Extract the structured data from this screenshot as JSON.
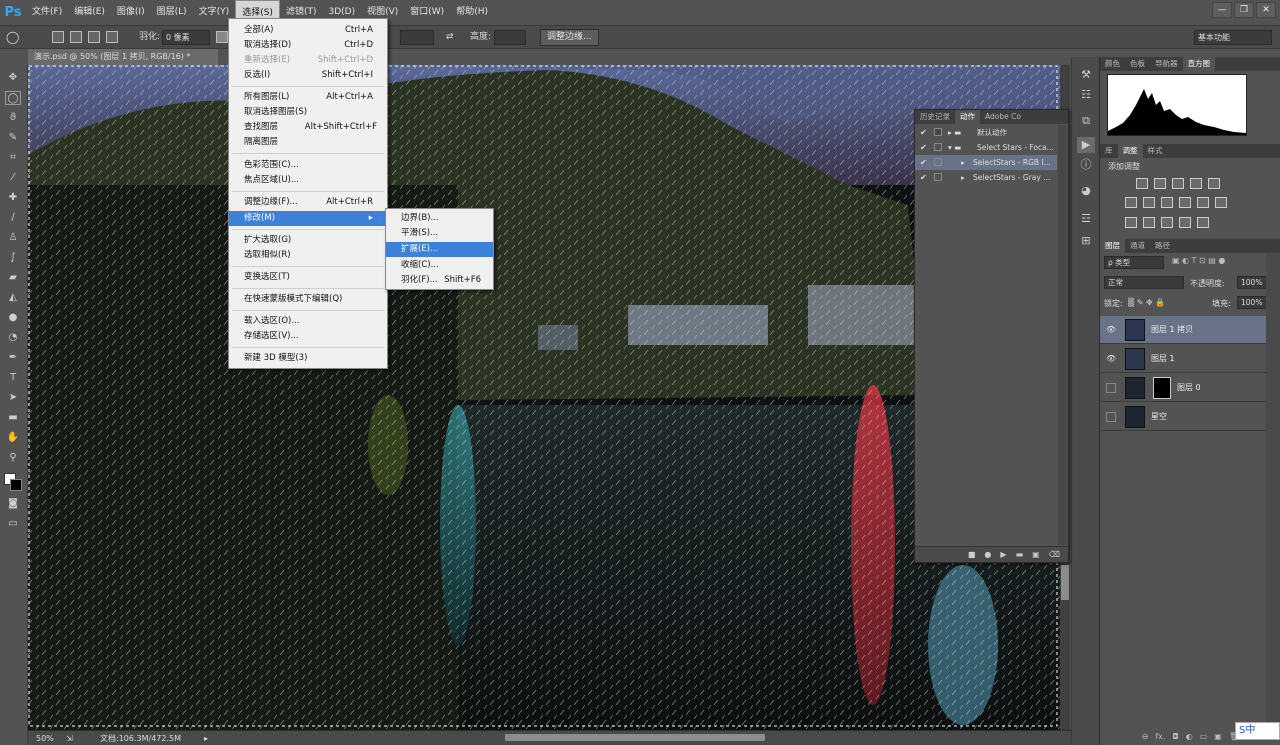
{
  "app": {
    "logo": "Ps"
  },
  "menubar": [
    "文件(F)",
    "编辑(E)",
    "图像(I)",
    "图层(L)",
    "文字(Y)",
    "选择(S)",
    "滤镜(T)",
    "3D(D)",
    "视图(V)",
    "窗口(W)",
    "帮助(H)"
  ],
  "window_controls": [
    "—",
    "❐",
    "✕"
  ],
  "options": {
    "feather_label": "羽化:",
    "feather_value": "0 像素",
    "height_label": "高度:",
    "refine_edge_button": "调整边缘...",
    "workspace": "基本功能"
  },
  "document": {
    "tab_title": "演示.psd @ 50% (图层 1 拷贝, RGB/16) *",
    "zoom": "50%",
    "doc_size": "文档:106.3M/472.5M"
  },
  "select_menu": [
    {
      "label": "全部(A)",
      "shortcut": "Ctrl+A"
    },
    {
      "label": "取消选择(D)",
      "shortcut": "Ctrl+D"
    },
    {
      "label": "重新选择(E)",
      "shortcut": "Shift+Ctrl+D"
    },
    {
      "label": "反选(I)",
      "shortcut": "Shift+Ctrl+I"
    },
    {
      "label": "所有图层(L)",
      "shortcut": "Alt+Ctrl+A"
    },
    {
      "label": "取消选择图层(S)",
      "shortcut": ""
    },
    {
      "label": "查找图层",
      "shortcut": "Alt+Shift+Ctrl+F"
    },
    {
      "label": "隔离图层",
      "shortcut": ""
    },
    {
      "label": "色彩范围(C)...",
      "shortcut": ""
    },
    {
      "label": "焦点区域(U)...",
      "shortcut": ""
    },
    {
      "label": "调整边缘(F)...",
      "shortcut": "Alt+Ctrl+R"
    },
    {
      "label": "修改(M)",
      "shortcut": "▸"
    },
    {
      "label": "扩大选取(G)",
      "shortcut": ""
    },
    {
      "label": "选取相似(R)",
      "shortcut": ""
    },
    {
      "label": "变换选区(T)",
      "shortcut": ""
    },
    {
      "label": "在快速蒙版模式下编辑(Q)",
      "shortcut": ""
    },
    {
      "label": "载入选区(O)...",
      "shortcut": ""
    },
    {
      "label": "存储选区(V)...",
      "shortcut": ""
    },
    {
      "label": "新建 3D 模型(3)",
      "shortcut": ""
    }
  ],
  "modify_submenu": [
    {
      "label": "边界(B)...",
      "shortcut": ""
    },
    {
      "label": "平滑(S)...",
      "shortcut": ""
    },
    {
      "label": "扩展(E)...",
      "shortcut": ""
    },
    {
      "label": "收缩(C)...",
      "shortcut": ""
    },
    {
      "label": "羽化(F)...",
      "shortcut": "Shift+F6"
    }
  ],
  "actions_panel": {
    "tabs": [
      "历史记录",
      "动作",
      "Adobe Co"
    ],
    "rows": [
      "默认动作",
      "Select Stars - Foca...",
      "SelectStars - RGB I...",
      "SelectStars - Gray ..."
    ]
  },
  "right_panel": {
    "top_tabs": [
      "颜色",
      "色板",
      "导航器",
      "直方图"
    ],
    "histogram_warning": "▲",
    "mid_tabs": [
      "库",
      "调整",
      "样式"
    ],
    "adjust_title": "添加调整",
    "layer_tabs": [
      "图层",
      "通道",
      "路径"
    ],
    "filter_kind": "ρ 类型",
    "blend_mode": "正常",
    "opacity_label": "不透明度:",
    "opacity_value": "100%",
    "lock_label": "锁定:",
    "fill_label": "填充:",
    "fill_value": "100%",
    "layers": [
      {
        "name": "图层 1 拷贝",
        "visible": true,
        "selected": true
      },
      {
        "name": "图层 1",
        "visible": true,
        "selected": false
      },
      {
        "name": "图层 0",
        "visible": false,
        "selected": false
      },
      {
        "name": "星空",
        "visible": false,
        "selected": false
      }
    ],
    "footer_icons": [
      "⊖",
      "fx.",
      "◘",
      "◐",
      "▭",
      "▣",
      "🗑"
    ]
  },
  "ime": "S中"
}
